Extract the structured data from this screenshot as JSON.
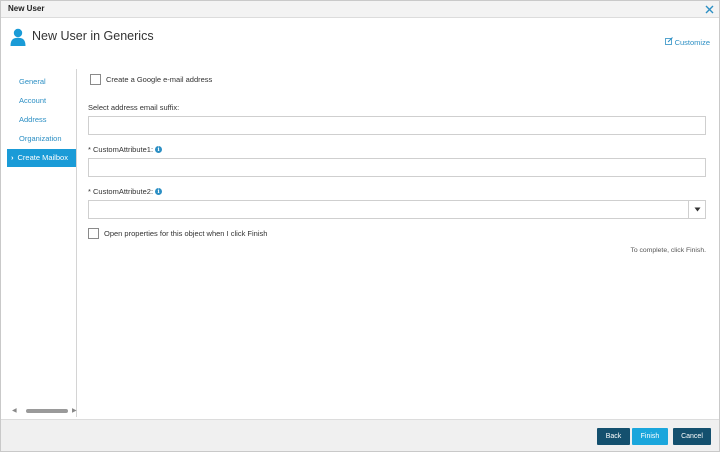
{
  "window": {
    "title": "New User",
    "close_icon": "close-icon"
  },
  "header": {
    "title": "New User in Generics",
    "icon": "user-icon",
    "customize_label": "Customize",
    "customize_icon": "edit-icon"
  },
  "sidebar": {
    "items": [
      {
        "label": "General",
        "active": false
      },
      {
        "label": "Account",
        "active": false
      },
      {
        "label": "Address",
        "active": false
      },
      {
        "label": "Organization",
        "active": false
      },
      {
        "label": "Create Mailbox",
        "active": true
      }
    ]
  },
  "form": {
    "google_checkbox_label": "Create a Google e-mail address",
    "google_checked": false,
    "suffix_label": "Select address email suffix:",
    "suffix_value": "",
    "attr1_label": "* CustomAttribute1:",
    "attr1_value": "",
    "attr2_label": "* CustomAttribute2:",
    "attr2_value": "",
    "open_props_label": "Open properties for this object when I click Finish",
    "open_props_checked": false,
    "hint": "To complete, click Finish."
  },
  "footer": {
    "back": "Back",
    "finish": "Finish",
    "cancel": "Cancel"
  },
  "colors": {
    "accent": "#1a9bd7",
    "link": "#2c8fc4",
    "dark_button": "#14506e",
    "finish_button": "#1aa6dc"
  }
}
